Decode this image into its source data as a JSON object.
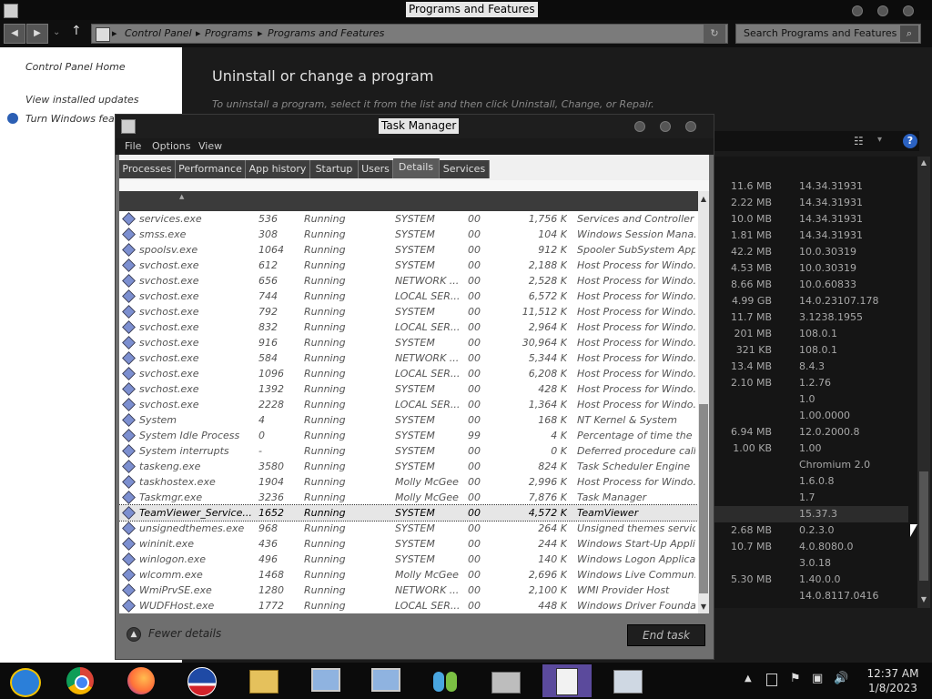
{
  "pf": {
    "title": "Programs and Features",
    "breadcrumb": [
      "Control Panel",
      "Programs",
      "Programs and Features"
    ],
    "search_placeholder": "Search Programs and Features",
    "left_links": [
      "Control Panel Home",
      "View installed updates",
      "Turn Windows feat"
    ],
    "heading": "Uninstall or change a program",
    "subheading": "To uninstall a program, select it from the list and then click Uninstall, Change, or Repair.",
    "list": [
      {
        "size": "11.6 MB",
        "version": "14.34.31931"
      },
      {
        "size": "2.22 MB",
        "version": "14.34.31931"
      },
      {
        "size": "10.0 MB",
        "version": "14.34.31931"
      },
      {
        "size": "1.81 MB",
        "version": "14.34.31931"
      },
      {
        "size": "42.2 MB",
        "version": "10.0.30319"
      },
      {
        "size": "4.53 MB",
        "version": "10.0.30319"
      },
      {
        "size": "8.66 MB",
        "version": "10.0.60833"
      },
      {
        "size": "4.99 GB",
        "version": "14.0.23107.178"
      },
      {
        "size": "11.7 MB",
        "version": "3.1238.1955"
      },
      {
        "size": "201 MB",
        "version": "108.0.1"
      },
      {
        "size": "321 KB",
        "version": "108.0.1"
      },
      {
        "size": "13.4 MB",
        "version": "8.4.3"
      },
      {
        "size": "2.10 MB",
        "version": "1.2.76"
      },
      {
        "size": "",
        "version": "1.0"
      },
      {
        "size": "",
        "version": "1.00.0000"
      },
      {
        "size": "6.94 MB",
        "version": "12.0.2000.8"
      },
      {
        "size": "1.00 KB",
        "version": "1.00"
      },
      {
        "size": "",
        "version": "Chromium 2.0"
      },
      {
        "size": "",
        "version": "1.6.0.8"
      },
      {
        "size": "",
        "version": "1.7"
      },
      {
        "size": "",
        "version": "15.37.3"
      },
      {
        "size": "2.68 MB",
        "version": "0.2.3.0"
      },
      {
        "size": "10.7 MB",
        "version": "4.0.8080.0"
      },
      {
        "size": "",
        "version": "3.0.18"
      },
      {
        "size": "5.30 MB",
        "version": "1.40.0.0"
      },
      {
        "size": "",
        "version": "14.0.8117.0416"
      }
    ]
  },
  "tm": {
    "title": "Task Manager",
    "menu": [
      "File",
      "Options",
      "View"
    ],
    "tabs": [
      "Processes",
      "Performance",
      "App history",
      "Startup",
      "Users",
      "Details",
      "Services"
    ],
    "active_tab": "Details",
    "rows": [
      {
        "name": "services.exe",
        "pid": "536",
        "status": "Running",
        "user": "SYSTEM",
        "cpu": "00",
        "mem": "1,756 K",
        "desc": "Services and Controller ..."
      },
      {
        "name": "smss.exe",
        "pid": "308",
        "status": "Running",
        "user": "SYSTEM",
        "cpu": "00",
        "mem": "104 K",
        "desc": "Windows Session Mana..."
      },
      {
        "name": "spoolsv.exe",
        "pid": "1064",
        "status": "Running",
        "user": "SYSTEM",
        "cpu": "00",
        "mem": "912 K",
        "desc": "Spooler SubSystem App"
      },
      {
        "name": "svchost.exe",
        "pid": "612",
        "status": "Running",
        "user": "SYSTEM",
        "cpu": "00",
        "mem": "2,188 K",
        "desc": "Host Process for Windo..."
      },
      {
        "name": "svchost.exe",
        "pid": "656",
        "status": "Running",
        "user": "NETWORK ...",
        "cpu": "00",
        "mem": "2,528 K",
        "desc": "Host Process for Windo..."
      },
      {
        "name": "svchost.exe",
        "pid": "744",
        "status": "Running",
        "user": "LOCAL SER...",
        "cpu": "00",
        "mem": "6,572 K",
        "desc": "Host Process for Windo..."
      },
      {
        "name": "svchost.exe",
        "pid": "792",
        "status": "Running",
        "user": "SYSTEM",
        "cpu": "00",
        "mem": "11,512 K",
        "desc": "Host Process for Windo..."
      },
      {
        "name": "svchost.exe",
        "pid": "832",
        "status": "Running",
        "user": "LOCAL SER...",
        "cpu": "00",
        "mem": "2,964 K",
        "desc": "Host Process for Windo..."
      },
      {
        "name": "svchost.exe",
        "pid": "916",
        "status": "Running",
        "user": "SYSTEM",
        "cpu": "00",
        "mem": "30,964 K",
        "desc": "Host Process for Windo..."
      },
      {
        "name": "svchost.exe",
        "pid": "584",
        "status": "Running",
        "user": "NETWORK ...",
        "cpu": "00",
        "mem": "5,344 K",
        "desc": "Host Process for Windo..."
      },
      {
        "name": "svchost.exe",
        "pid": "1096",
        "status": "Running",
        "user": "LOCAL SER...",
        "cpu": "00",
        "mem": "6,208 K",
        "desc": "Host Process for Windo..."
      },
      {
        "name": "svchost.exe",
        "pid": "1392",
        "status": "Running",
        "user": "SYSTEM",
        "cpu": "00",
        "mem": "428 K",
        "desc": "Host Process for Windo..."
      },
      {
        "name": "svchost.exe",
        "pid": "2228",
        "status": "Running",
        "user": "LOCAL SER...",
        "cpu": "00",
        "mem": "1,364 K",
        "desc": "Host Process for Windo..."
      },
      {
        "name": "System",
        "pid": "4",
        "status": "Running",
        "user": "SYSTEM",
        "cpu": "00",
        "mem": "168 K",
        "desc": "NT Kernel & System"
      },
      {
        "name": "System Idle Process",
        "pid": "0",
        "status": "Running",
        "user": "SYSTEM",
        "cpu": "99",
        "mem": "4 K",
        "desc": "Percentage of time the ..."
      },
      {
        "name": "System interrupts",
        "pid": "-",
        "status": "Running",
        "user": "SYSTEM",
        "cpu": "00",
        "mem": "0 K",
        "desc": "Deferred procedure call..."
      },
      {
        "name": "taskeng.exe",
        "pid": "3580",
        "status": "Running",
        "user": "SYSTEM",
        "cpu": "00",
        "mem": "824 K",
        "desc": "Task Scheduler Engine"
      },
      {
        "name": "taskhostex.exe",
        "pid": "1904",
        "status": "Running",
        "user": "Molly McGee",
        "cpu": "00",
        "mem": "2,996 K",
        "desc": "Host Process for Windo..."
      },
      {
        "name": "Taskmgr.exe",
        "pid": "3236",
        "status": "Running",
        "user": "Molly McGee",
        "cpu": "00",
        "mem": "7,876 K",
        "desc": "Task Manager"
      },
      {
        "name": "TeamViewer_Service....",
        "pid": "1652",
        "status": "Running",
        "user": "SYSTEM",
        "cpu": "00",
        "mem": "4,572 K",
        "desc": "TeamViewer",
        "selected": true
      },
      {
        "name": "unsignedthemes.exe",
        "pid": "968",
        "status": "Running",
        "user": "SYSTEM",
        "cpu": "00",
        "mem": "264 K",
        "desc": "Unsigned themes servic..."
      },
      {
        "name": "wininit.exe",
        "pid": "436",
        "status": "Running",
        "user": "SYSTEM",
        "cpu": "00",
        "mem": "244 K",
        "desc": "Windows Start-Up Appli..."
      },
      {
        "name": "winlogon.exe",
        "pid": "496",
        "status": "Running",
        "user": "SYSTEM",
        "cpu": "00",
        "mem": "140 K",
        "desc": "Windows Logon Applica..."
      },
      {
        "name": "wlcomm.exe",
        "pid": "1468",
        "status": "Running",
        "user": "Molly McGee",
        "cpu": "00",
        "mem": "2,696 K",
        "desc": "Windows Live Commun..."
      },
      {
        "name": "WmiPrvSE.exe",
        "pid": "1280",
        "status": "Running",
        "user": "NETWORK ...",
        "cpu": "00",
        "mem": "2,100 K",
        "desc": "WMI Provider Host"
      },
      {
        "name": "WUDFHost.exe",
        "pid": "1772",
        "status": "Running",
        "user": "LOCAL SER...",
        "cpu": "00",
        "mem": "448 K",
        "desc": "Windows Driver Founda..."
      }
    ],
    "fewer_details": "Fewer details",
    "end_task": "End task"
  },
  "taskbar": {
    "apps": [
      "windows-media-icon",
      "chrome-icon",
      "firefox-icon",
      "obama-logo-icon",
      "file-explorer-icon",
      "remote-desktop-icon",
      "remote-desktop-icon",
      "messenger-icon",
      "cash-register-icon",
      "task-manager-icon",
      "control-panel-icon"
    ],
    "time": "12:37 AM",
    "date": "1/8/2023"
  }
}
